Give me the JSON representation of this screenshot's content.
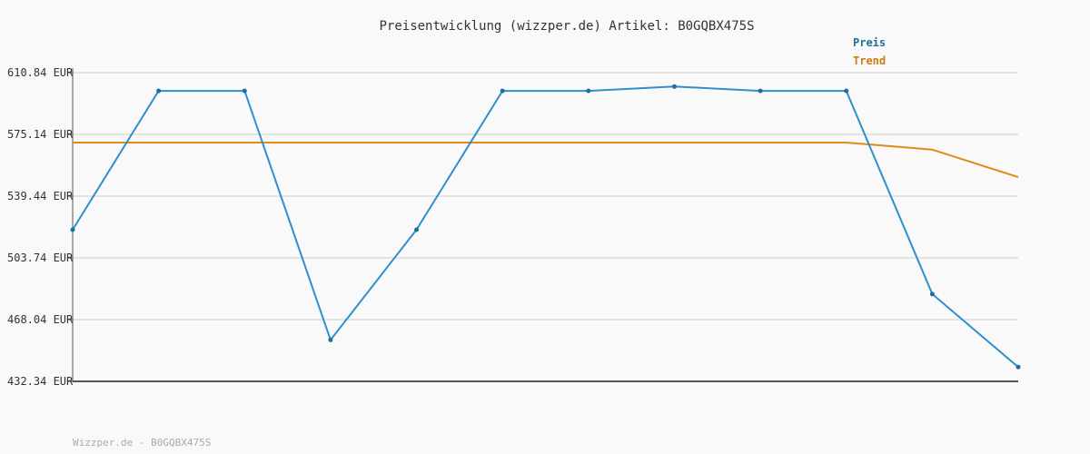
{
  "chart_data": {
    "type": "line",
    "title": "Preisentwicklung (wizzper.de) Artikel: B0GQBX475S",
    "xlabel": "",
    "ylabel": "",
    "ylim": [
      432.34,
      610.84
    ],
    "yticks": [
      "610.84 EUR",
      "575.14 EUR",
      "539.44 EUR",
      "503.74 EUR",
      "468.04 EUR",
      "432.34 EUR"
    ],
    "ytick_values": [
      610.84,
      575.14,
      539.44,
      503.74,
      468.04,
      432.34
    ],
    "x": [
      0,
      1,
      2,
      3,
      4,
      5,
      6,
      7,
      8,
      9,
      10,
      11
    ],
    "grid": true,
    "legend_position": "top-right",
    "series": [
      {
        "name": "Preis",
        "color": "#2f8fcc",
        "label_color": "#1f6f9a",
        "values": [
          520.0,
          600.3,
          600.3,
          456.3,
          520.0,
          600.3,
          600.3,
          602.8,
          600.3,
          600.3,
          482.8,
          440.6
        ]
      },
      {
        "name": "Trend",
        "color": "#e0891a",
        "label_color": "#d07b10",
        "values": [
          570.4,
          570.4,
          570.4,
          570.4,
          570.4,
          570.4,
          570.4,
          570.4,
          570.4,
          570.4,
          566.3,
          550.4
        ]
      }
    ]
  },
  "footer": "Wizzper.de - B0GQBX475S",
  "colors": {
    "grid": "#e3e3e3",
    "axis": "#555555",
    "background": "#f9f9f9"
  }
}
